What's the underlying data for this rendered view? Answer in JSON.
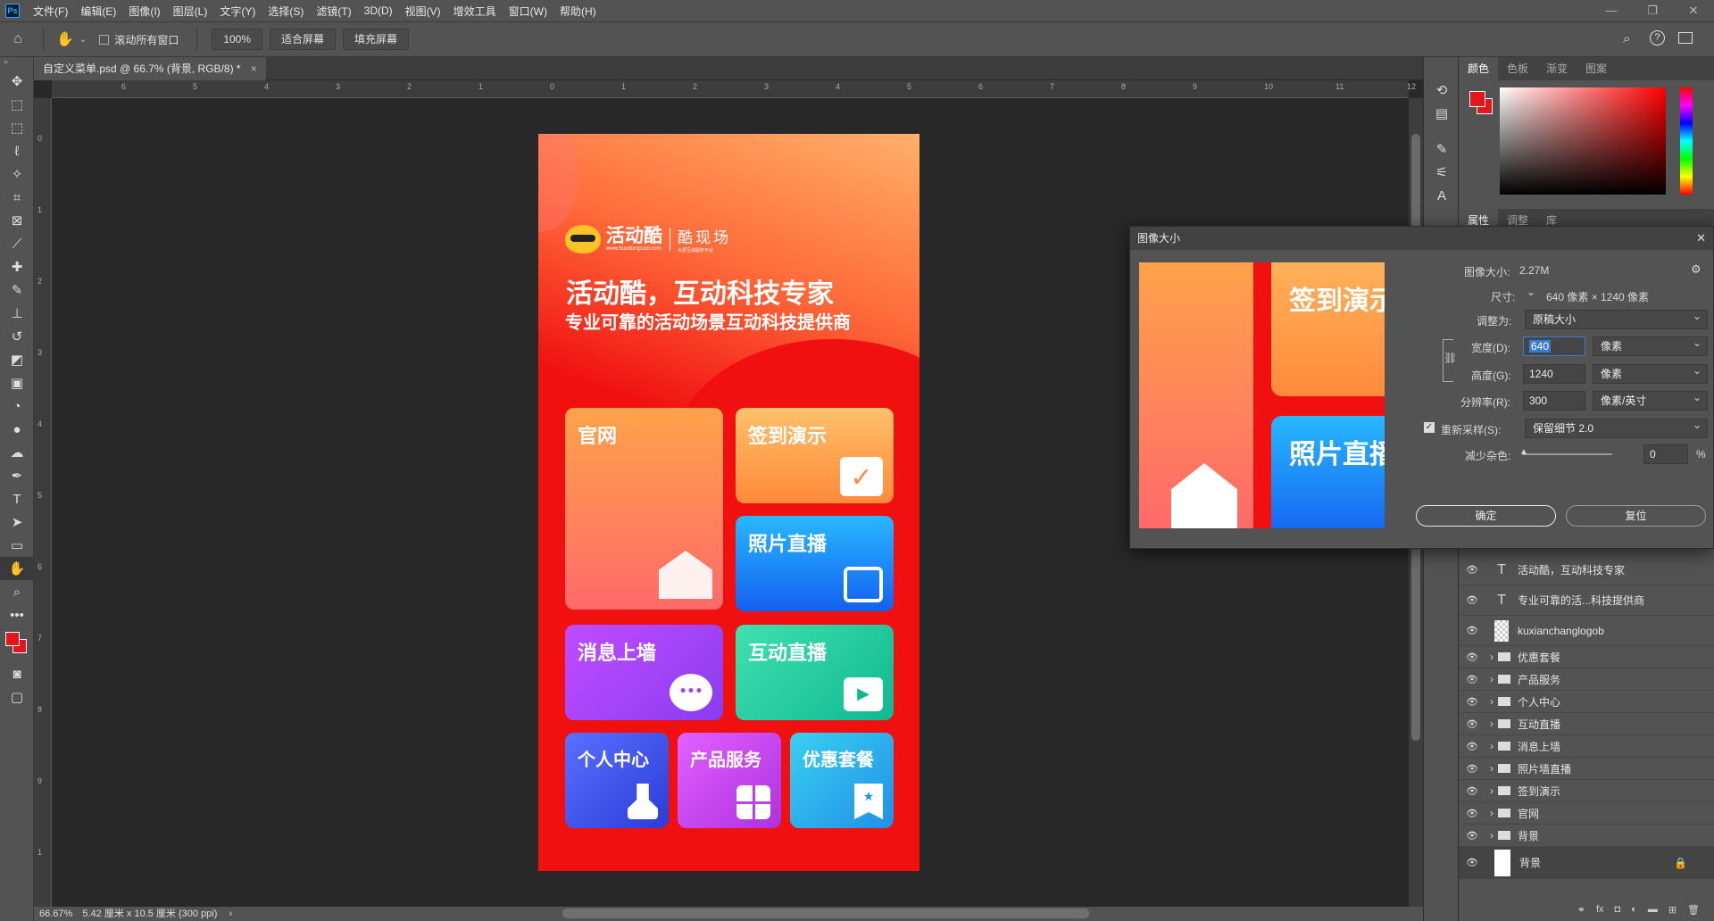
{
  "menu": [
    "文件(F)",
    "编辑(E)",
    "图像(I)",
    "图层(L)",
    "文字(Y)",
    "选择(S)",
    "滤镜(T)",
    "3D(D)",
    "视图(V)",
    "增效工具",
    "窗口(W)",
    "帮助(H)"
  ],
  "window_controls": [
    "—",
    "❐",
    "✕"
  ],
  "options": {
    "scroll_all_label": "滚动所有窗口",
    "zoom_value": "100%",
    "fit_screen": "适合屏幕",
    "fill_screen": "填充屏幕"
  },
  "document": {
    "tab_title": "自定义菜单.psd @ 66.7% (背景, RGB/8) *",
    "close": "×"
  },
  "status": {
    "zoom": "66.67%",
    "info": "5.42 厘米 x 10.5 厘米 (300 ppi)"
  },
  "ruler_h": [
    "6",
    "5",
    "4",
    "3",
    "2",
    "1",
    "0",
    "1",
    "2",
    "3",
    "4",
    "5",
    "6",
    "7",
    "8",
    "9",
    "10",
    "11",
    "12"
  ],
  "ruler_v": [
    "0",
    "1",
    "2",
    "3",
    "4",
    "5",
    "6",
    "7",
    "8",
    "9",
    "1"
  ],
  "artboard": {
    "logo_text": "活动酷",
    "logo_sub": "酷现场",
    "logo_url": "www.huodongcool.com",
    "logo_small": "大屏互动服务平台",
    "headline": "活动酷，互动科技专家",
    "subline": "专业可靠的活动场景互动科技提供商",
    "tiles": [
      "官网",
      "签到演示",
      "照片直播",
      "消息上墙",
      "互动直播",
      "个人中心",
      "产品服务",
      "优惠套餐"
    ]
  },
  "color_panel": {
    "tabs": [
      "颜色",
      "色板",
      "渐变",
      "图案"
    ],
    "foreground": "#e8141c"
  },
  "props_panel": {
    "tabs": [
      "属性",
      "调整",
      "库"
    ]
  },
  "layers": [
    {
      "type": "text",
      "name": "活动酷，互动科技专家"
    },
    {
      "type": "text",
      "name": "专业可靠的活...科技提供商"
    },
    {
      "type": "image",
      "name": "kuxianchanglogob"
    },
    {
      "type": "group",
      "name": "优惠套餐"
    },
    {
      "type": "group",
      "name": "产品服务"
    },
    {
      "type": "group",
      "name": "个人中心"
    },
    {
      "type": "group",
      "name": "互动直播"
    },
    {
      "type": "group",
      "name": "消息上墙"
    },
    {
      "type": "group",
      "name": "照片墙直播"
    },
    {
      "type": "group",
      "name": "签到演示"
    },
    {
      "type": "group",
      "name": "官网"
    },
    {
      "type": "group",
      "name": "背景"
    },
    {
      "type": "background",
      "name": "背景"
    }
  ],
  "dialog": {
    "title": "图像大小",
    "close": "✕",
    "image_size_label": "图像大小:",
    "image_size_value": "2.27M",
    "dimensions_label": "尺寸:",
    "dimensions_value": "640 像素 × 1240 像素",
    "fit_to_label": "调整为:",
    "fit_to_value": "原稿大小",
    "width_label": "宽度(D):",
    "width_value": "640",
    "width_unit": "像素",
    "height_label": "高度(G):",
    "height_value": "1240",
    "height_unit": "像素",
    "resolution_label": "分辨率(R):",
    "resolution_value": "300",
    "resolution_unit": "像素/英寸",
    "resample_label": "重新采样(S):",
    "resample_value": "保留细节 2.0",
    "noise_label": "减少杂色:",
    "noise_value": "0",
    "noise_unit": "%",
    "ok": "确定",
    "reset": "复位",
    "preview_tiles": [
      "签到演示",
      "照片直播"
    ]
  }
}
